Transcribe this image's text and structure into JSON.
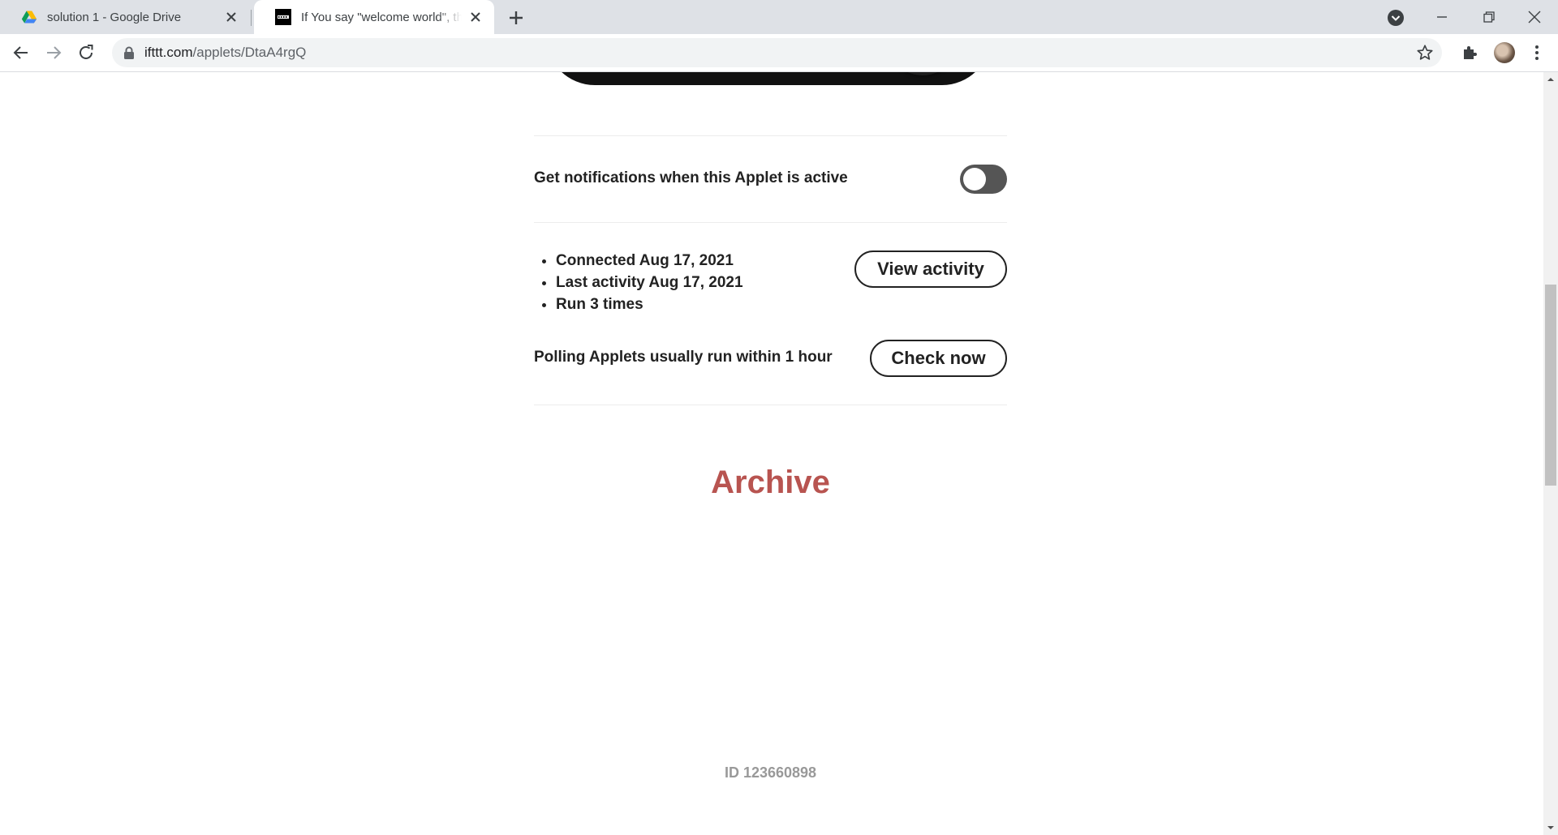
{
  "browser": {
    "tabs": [
      {
        "title": "solution 1 - Google Drive",
        "favicon": "google-drive-icon",
        "active": false
      },
      {
        "title": "If You say \"welcome world\", then",
        "favicon": "ifttt-icon",
        "active": true
      }
    ],
    "address": {
      "host": "ifttt.com",
      "path": "/applets/DtaA4rgQ"
    }
  },
  "applet": {
    "notifications_label": "Get notifications when this Applet is active",
    "notifications_on": false,
    "stats": [
      "Connected Aug 17, 2021",
      "Last activity Aug 17, 2021",
      "Run 3 times"
    ],
    "view_activity_label": "View activity",
    "polling_text": "Polling Applets usually run within 1 hour",
    "check_now_label": "Check now",
    "archive_label": "Archive",
    "id_text": "ID 123660898"
  },
  "colors": {
    "archive": "#b85450",
    "toggle_off": "#555555",
    "id_text": "#999999"
  }
}
